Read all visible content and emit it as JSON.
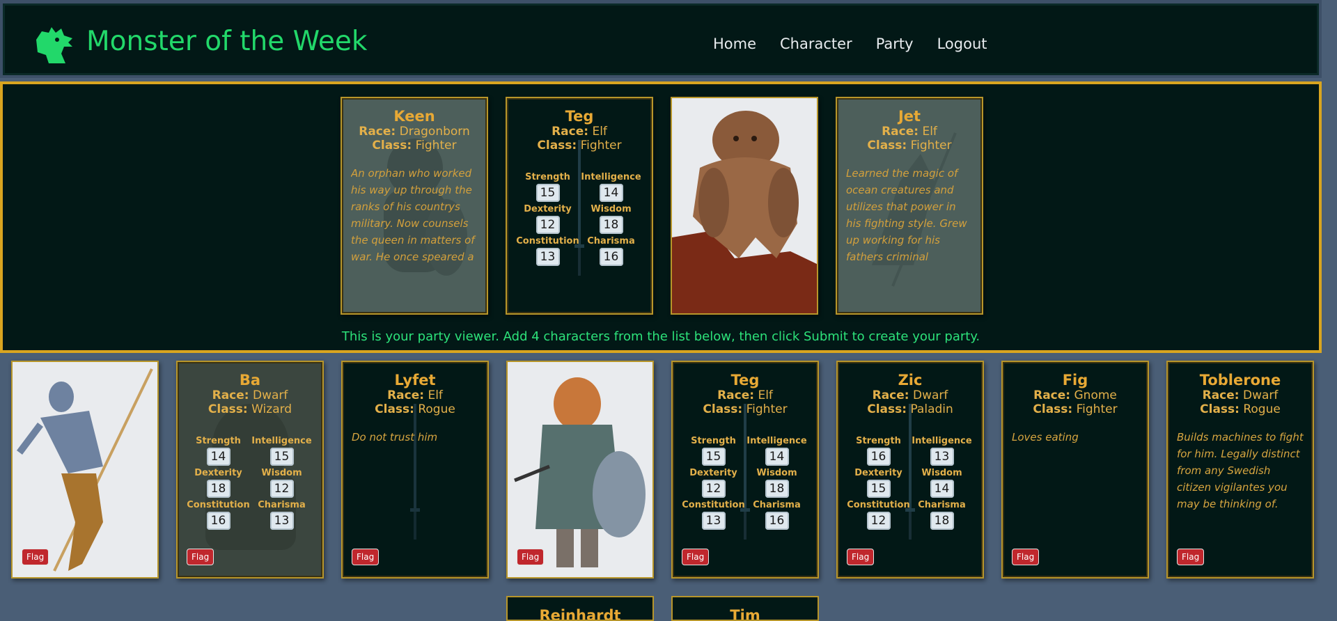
{
  "header": {
    "title": "Monster of the Week",
    "nav": [
      "Home",
      "Character",
      "Party",
      "Logout"
    ]
  },
  "party_viewer": {
    "message": "This is your party viewer. Add 4 characters from the list below, then click Submit to create your party.",
    "cards": [
      {
        "name": "Keen",
        "race": "Dragonborn",
        "class": "Fighter",
        "description": "An orphan who worked his way up through the ranks of his countrys military. Now counsels the queen in matters of war. He once speared a"
      },
      {
        "name": "Teg",
        "race": "Elf",
        "class": "Fighter",
        "stats": {
          "strength": "15",
          "intelligence": "14",
          "dexterity": "12",
          "wisdom": "18",
          "constitution": "13",
          "charisma": "16"
        }
      },
      {
        "image": "rock-golem"
      },
      {
        "name": "Jet",
        "race": "Elf",
        "class": "Fighter",
        "description": "Learned the magic of ocean creatures and utilizes that power in his fighting style. Grew up working for his fathers criminal organization."
      }
    ]
  },
  "labels": {
    "race": "Race:",
    "class": "Class:",
    "flag": "Flag",
    "strength": "Strength",
    "intelligence": "Intelligence",
    "dexterity": "Dexterity",
    "wisdom": "Wisdom",
    "constitution": "Constitution",
    "charisma": "Charisma"
  },
  "roster": [
    {
      "image": "elf-archer"
    },
    {
      "name": "Ba",
      "race": "Dwarf",
      "class": "Wizard",
      "stats": {
        "strength": "14",
        "intelligence": "15",
        "dexterity": "18",
        "wisdom": "12",
        "constitution": "16",
        "charisma": "13"
      }
    },
    {
      "name": "Lyfet",
      "race": "Elf",
      "class": "Rogue",
      "description": "Do not trust him"
    },
    {
      "image": "dragonborn-warrior"
    },
    {
      "name": "Teg",
      "race": "Elf",
      "class": "Fighter",
      "stats": {
        "strength": "15",
        "intelligence": "14",
        "dexterity": "12",
        "wisdom": "18",
        "constitution": "13",
        "charisma": "16"
      }
    },
    {
      "name": "Zic",
      "race": "Dwarf",
      "class": "Paladin",
      "stats": {
        "strength": "16",
        "intelligence": "13",
        "dexterity": "15",
        "wisdom": "14",
        "constitution": "12",
        "charisma": "18"
      }
    },
    {
      "name": "Fig",
      "race": "Gnome",
      "class": "Fighter",
      "description": "Loves eating"
    },
    {
      "name": "Toblerone",
      "race": "Dwarf",
      "class": "Rogue",
      "description": "Builds machines to fight for him. Legally distinct from any Swedish citizen vigilantes you may be thinking of."
    }
  ],
  "roster_row2": [
    {
      "name": "Reinhardt"
    },
    {
      "name": "Tim"
    }
  ],
  "colors": {
    "accent_green": "#22d86a",
    "gold": "#d9a520",
    "card_bg": "#021816",
    "page_bg": "#4a5e76",
    "flag_red": "#c0272d"
  }
}
